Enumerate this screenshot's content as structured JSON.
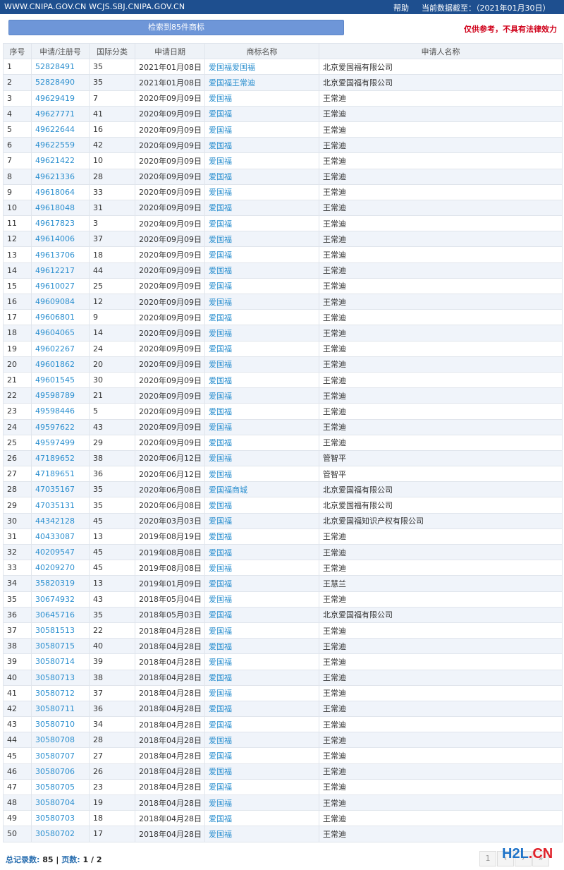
{
  "header": {
    "site": "WWW.CNIPA.GOV.CN WCJS.SBJ.CNIPA.GOV.CN",
    "help": "帮助",
    "data_as_of": "当前数据截至：（2021年01月30日）"
  },
  "search": {
    "result_label": "检索到85件商标",
    "disclaimer": "仅供参考，不具有法律效力"
  },
  "table": {
    "columns": [
      "序号",
      "申请/注册号",
      "国际分类",
      "申请日期",
      "商标名称",
      "申请人名称"
    ],
    "rows": [
      [
        "1",
        "52828491",
        "35",
        "2021年01月08日",
        "爱国福爱国福",
        "北京爱国福有限公司"
      ],
      [
        "2",
        "52828490",
        "35",
        "2021年01月08日",
        "爱国福王常迪",
        "北京爱国福有限公司"
      ],
      [
        "3",
        "49629419",
        "7",
        "2020年09月09日",
        "爱国福",
        "王常迪"
      ],
      [
        "4",
        "49627771",
        "41",
        "2020年09月09日",
        "爱国福",
        "王常迪"
      ],
      [
        "5",
        "49622644",
        "16",
        "2020年09月09日",
        "爱国福",
        "王常迪"
      ],
      [
        "6",
        "49622559",
        "42",
        "2020年09月09日",
        "爱国福",
        "王常迪"
      ],
      [
        "7",
        "49621422",
        "10",
        "2020年09月09日",
        "爱国福",
        "王常迪"
      ],
      [
        "8",
        "49621336",
        "28",
        "2020年09月09日",
        "爱国福",
        "王常迪"
      ],
      [
        "9",
        "49618064",
        "33",
        "2020年09月09日",
        "爱国福",
        "王常迪"
      ],
      [
        "10",
        "49618048",
        "31",
        "2020年09月09日",
        "爱国福",
        "王常迪"
      ],
      [
        "11",
        "49617823",
        "3",
        "2020年09月09日",
        "爱国福",
        "王常迪"
      ],
      [
        "12",
        "49614006",
        "37",
        "2020年09月09日",
        "爱国福",
        "王常迪"
      ],
      [
        "13",
        "49613706",
        "18",
        "2020年09月09日",
        "爱国福",
        "王常迪"
      ],
      [
        "14",
        "49612217",
        "44",
        "2020年09月09日",
        "爱国福",
        "王常迪"
      ],
      [
        "15",
        "49610027",
        "25",
        "2020年09月09日",
        "爱国福",
        "王常迪"
      ],
      [
        "16",
        "49609084",
        "12",
        "2020年09月09日",
        "爱国福",
        "王常迪"
      ],
      [
        "17",
        "49606801",
        "9",
        "2020年09月09日",
        "爱国福",
        "王常迪"
      ],
      [
        "18",
        "49604065",
        "14",
        "2020年09月09日",
        "爱国福",
        "王常迪"
      ],
      [
        "19",
        "49602267",
        "24",
        "2020年09月09日",
        "爱国福",
        "王常迪"
      ],
      [
        "20",
        "49601862",
        "20",
        "2020年09月09日",
        "爱国福",
        "王常迪"
      ],
      [
        "21",
        "49601545",
        "30",
        "2020年09月09日",
        "爱国福",
        "王常迪"
      ],
      [
        "22",
        "49598789",
        "21",
        "2020年09月09日",
        "爱国福",
        "王常迪"
      ],
      [
        "23",
        "49598446",
        "5",
        "2020年09月09日",
        "爱国福",
        "王常迪"
      ],
      [
        "24",
        "49597622",
        "43",
        "2020年09月09日",
        "爱国福",
        "王常迪"
      ],
      [
        "25",
        "49597499",
        "29",
        "2020年09月09日",
        "爱国福",
        "王常迪"
      ],
      [
        "26",
        "47189652",
        "38",
        "2020年06月12日",
        "爱国福",
        "管智平"
      ],
      [
        "27",
        "47189651",
        "36",
        "2020年06月12日",
        "爱国福",
        "管智平"
      ],
      [
        "28",
        "47035167",
        "35",
        "2020年06月08日",
        "爱国福商城",
        "北京爱国福有限公司"
      ],
      [
        "29",
        "47035131",
        "35",
        "2020年06月08日",
        "爱国福",
        "北京爱国福有限公司"
      ],
      [
        "30",
        "44342128",
        "45",
        "2020年03月03日",
        "爱国福",
        "北京爱国福知识产权有限公司"
      ],
      [
        "31",
        "40433087",
        "13",
        "2019年08月19日",
        "爱国福",
        "王常迪"
      ],
      [
        "32",
        "40209547",
        "45",
        "2019年08月08日",
        "爱国福",
        "王常迪"
      ],
      [
        "33",
        "40209270",
        "45",
        "2019年08月08日",
        "爱国福",
        "王常迪"
      ],
      [
        "34",
        "35820319",
        "13",
        "2019年01月09日",
        "爱国福",
        "王慧兰"
      ],
      [
        "35",
        "30674932",
        "43",
        "2018年05月04日",
        "爱国福",
        "王常迪"
      ],
      [
        "36",
        "30645716",
        "35",
        "2018年05月03日",
        "爱国福",
        "北京爱国福有限公司"
      ],
      [
        "37",
        "30581513",
        "22",
        "2018年04月28日",
        "爱国福",
        "王常迪"
      ],
      [
        "38",
        "30580715",
        "40",
        "2018年04月28日",
        "爱国福",
        "王常迪"
      ],
      [
        "39",
        "30580714",
        "39",
        "2018年04月28日",
        "爱国福",
        "王常迪"
      ],
      [
        "40",
        "30580713",
        "38",
        "2018年04月28日",
        "爱国福",
        "王常迪"
      ],
      [
        "41",
        "30580712",
        "37",
        "2018年04月28日",
        "爱国福",
        "王常迪"
      ],
      [
        "42",
        "30580711",
        "36",
        "2018年04月28日",
        "爱国福",
        "王常迪"
      ],
      [
        "43",
        "30580710",
        "34",
        "2018年04月28日",
        "爱国福",
        "王常迪"
      ],
      [
        "44",
        "30580708",
        "28",
        "2018年04月28日",
        "爱国福",
        "王常迪"
      ],
      [
        "45",
        "30580707",
        "27",
        "2018年04月28日",
        "爱国福",
        "王常迪"
      ],
      [
        "46",
        "30580706",
        "26",
        "2018年04月28日",
        "爱国福",
        "王常迪"
      ],
      [
        "47",
        "30580705",
        "23",
        "2018年04月28日",
        "爱国福",
        "王常迪"
      ],
      [
        "48",
        "30580704",
        "19",
        "2018年04月28日",
        "爱国福",
        "王常迪"
      ],
      [
        "49",
        "30580703",
        "18",
        "2018年04月28日",
        "爱国福",
        "王常迪"
      ],
      [
        "50",
        "30580702",
        "17",
        "2018年04月28日",
        "爱国福",
        "王常迪"
      ]
    ]
  },
  "footer": {
    "total_label": "总记录数:",
    "total_value": "85",
    "separator": "|",
    "pages_label": "页数:",
    "pages_value": "1 / 2"
  },
  "pager": {
    "current": "1",
    "prev": "‹",
    "next": "›",
    "last": "»"
  },
  "watermark": {
    "part1": "H2L",
    "part2": ".CN"
  },
  "colors": {
    "topbar": "#1e4f8f",
    "search_button": "#6e96d8",
    "link": "#2b8fcf",
    "disclaimer": "#d0021b"
  }
}
